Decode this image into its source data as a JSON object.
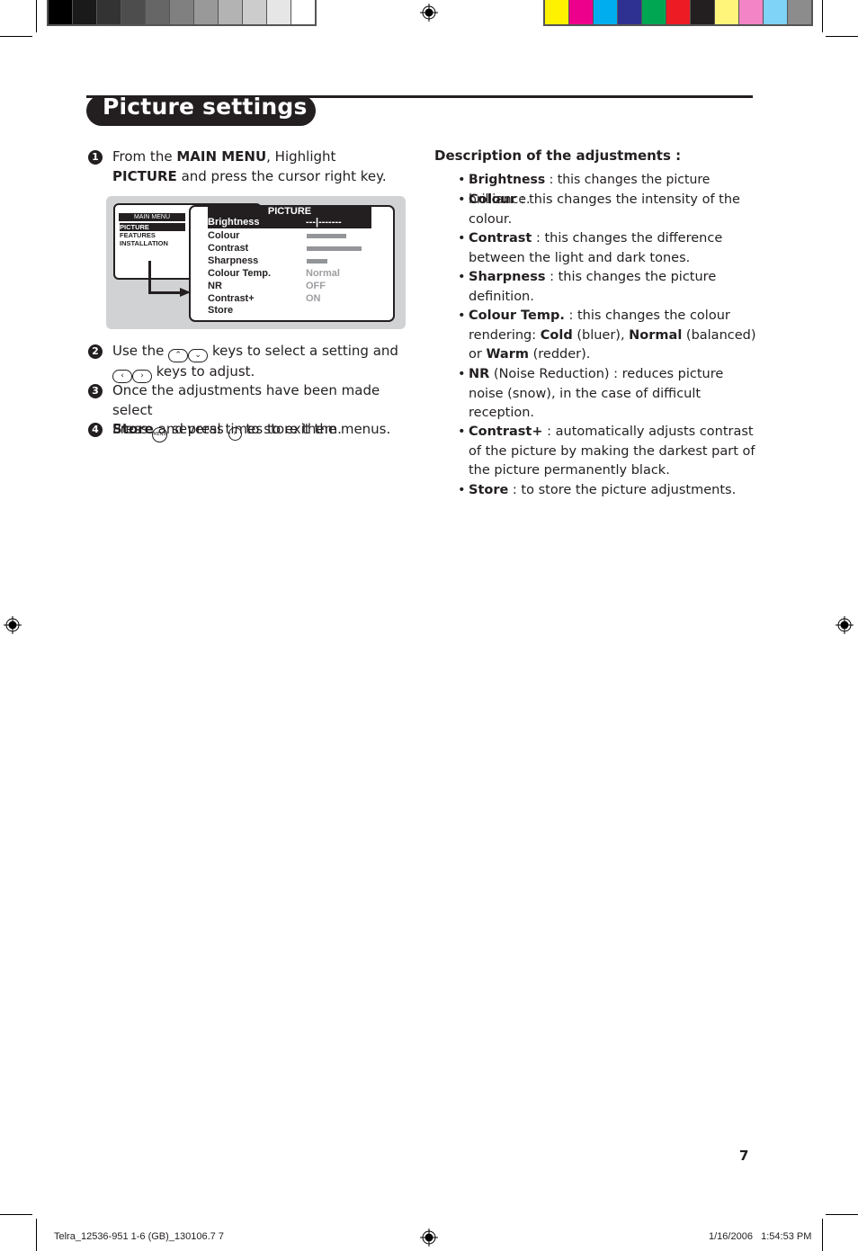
{
  "print_marks": {
    "grey_swatches": [
      "#000000",
      "#1a1a1a",
      "#333333",
      "#4d4d4d",
      "#666666",
      "#808080",
      "#999999",
      "#b3b3b3",
      "#cccccc",
      "#e6e6e6",
      "#ffffff"
    ],
    "color_swatches": [
      "#fff200",
      "#ec008c",
      "#00aeef",
      "#2e3192",
      "#00a651",
      "#ed1c24",
      "#231f20",
      "#fff57a",
      "#f385c6",
      "#7fd3f7",
      "#8c8c8c"
    ]
  },
  "title": "Picture settings",
  "steps": [
    {
      "number": "1",
      "parts": [
        {
          "text": "From the ",
          "bold": false
        },
        {
          "text": "MAIN MENU",
          "bold": true
        },
        {
          "text": ", Highlight ",
          "bold": false
        },
        {
          "text": "PICTURE",
          "bold": true
        },
        {
          "text": " and press the cursor right key.",
          "bold": false
        }
      ]
    },
    {
      "number": "2",
      "text_a": "Use the",
      "keys_a": [
        "up-key",
        "down-key"
      ],
      "text_b": "keys to select a setting and",
      "keys_b": [
        "left-key",
        "right-key"
      ],
      "text_c": "keys to adjust."
    },
    {
      "number": "3",
      "text_a": "Once the adjustments have been made select",
      "bold_word": "Store",
      "text_b": "and press",
      "key": "right-key",
      "text_c": "to store them."
    },
    {
      "number": "4",
      "text_a": "Press",
      "key": "menu-key",
      "key_label": "MENU",
      "text_b": "several times to exit the menus."
    }
  ],
  "key_glyphs": {
    "up": "⌃",
    "down": "⌄",
    "left": "‹",
    "right": "›"
  },
  "illustration": {
    "main_menu": {
      "title": "MAIN MENU",
      "items": [
        "PICTURE",
        "FEATURES",
        "INSTALLATION"
      ],
      "selected": "PICTURE"
    },
    "picture_menu": {
      "title": "PICTURE",
      "rows": [
        {
          "label": "Brightness",
          "value": "---|-------",
          "selected": true
        },
        {
          "label": "Colour",
          "bar_level": 0.6
        },
        {
          "label": "Contrast",
          "bar_level": 0.82
        },
        {
          "label": "Sharpness",
          "bar_level": 0.31
        },
        {
          "label": "Colour Temp.",
          "value": "Normal"
        },
        {
          "label": "NR",
          "value": "OFF"
        },
        {
          "label": "Contrast+",
          "value": "ON"
        },
        {
          "label": "Store"
        }
      ]
    }
  },
  "description": {
    "heading": "Description of the adjustments :",
    "items": [
      {
        "term": "Brightness",
        "text": " : this changes the picture brilliance."
      },
      {
        "term": "Colour",
        "text": " : this changes the intensity of the colour."
      },
      {
        "term": "Contrast",
        "text": " : this changes the difference between the light and dark tones."
      },
      {
        "term": "Sharpness",
        "text": " : this changes the picture definition."
      },
      {
        "term": "Colour Temp.",
        "text": " : this changes the colour rendering: ",
        "extra": [
          {
            "text": "Cold",
            "bold": true
          },
          {
            "text": " (bluer), ",
            "bold": false
          },
          {
            "text": "Normal",
            "bold": true
          },
          {
            "text": " (balanced) or ",
            "bold": false
          },
          {
            "text": "Warm",
            "bold": true
          },
          {
            "text": " (redder).",
            "bold": false
          }
        ]
      },
      {
        "term": "NR",
        "text": " (Noise Reduction) : reduces picture noise (snow), in the case of difficult reception."
      },
      {
        "term": "Contrast+",
        "text": " : automatically adjusts contrast of the picture by making the darkest part of the picture permanently black."
      },
      {
        "term": "Store",
        "text": " : to store the picture adjustments."
      }
    ]
  },
  "page_number": "7",
  "footer": {
    "file": "Telra_12536-951 1-6 (GB)_130106.7   7",
    "timestamp": "1/16/2006   1:54:53 PM"
  }
}
